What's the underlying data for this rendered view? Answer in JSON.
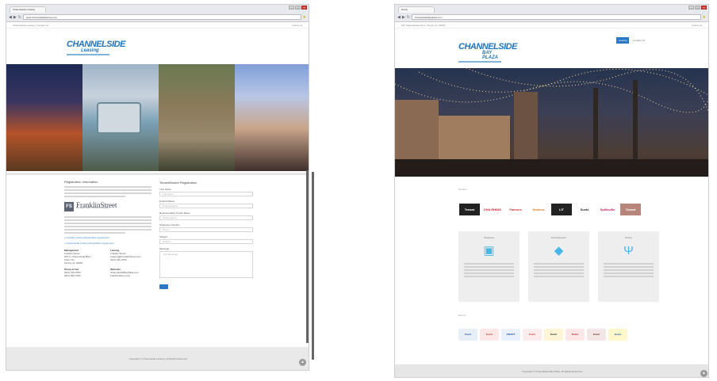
{
  "window_a": {
    "tab_title": "Channelside Leasing",
    "url": "www.channelsideleasing.com",
    "top_left": "Channelside Leasing  |  Contact Us",
    "top_right": "Follow us",
    "logo_title": "CHANNELSIDE",
    "logo_sub": "Leasing",
    "left_heading": "Registration Information",
    "franklin_mark": "FS",
    "franklin_name": "FranklinStreet",
    "franklin_tag": "Real Estate · Capital · Insurance · Management",
    "link1": "» Franklin Leasing Registration Agreement",
    "link2": "» Channelside Leasing Registration Agreement",
    "info": [
      {
        "label": "Management",
        "lines": [
          "Franklin Street",
          "615 S. Channelside Blvd",
          "Suite 734",
          "Tampa, FL 33602"
        ]
      },
      {
        "label": "Leasing",
        "lines": [
          "Franklin Street",
          "Leasing@FranklinStreet.com",
          "(813) 419-0780"
        ]
      },
      {
        "label": "Phone & Fax",
        "lines": [
          "(813) 419-0780",
          "(813) 839-7299"
        ]
      },
      {
        "label": "Websites",
        "lines": [
          "ChannelsideBayPlaza.com",
          "FranklinStreet.com"
        ]
      }
    ],
    "form_heading": "Tenant/Broker Registration",
    "fields": [
      {
        "label": "Your Name",
        "placeholder": "Full Name"
      },
      {
        "label": "Email Address",
        "placeholder": "Email Address"
      },
      {
        "label": "Representative Tenant Name",
        "placeholder": "Tenant Name"
      },
      {
        "label": "Telephone Number",
        "placeholder": "Phone"
      },
      {
        "label": "Subject",
        "placeholder": "Subject"
      }
    ],
    "message_label": "Message",
    "message_placeholder": "Your Message",
    "footer": "Copyright © Channelside Leasing. All Rights Reserved."
  },
  "window_b": {
    "tab_title": "Home",
    "url": "channelsidebayplaza.com",
    "top_left": "615 Channelside Drive, Tampa, FL 33602",
    "top_right": "Follow us",
    "logo_title": "CHANNELSIDE",
    "logo_sub": "BAY PLAZA",
    "nav_primary": "Leasing",
    "nav_secondary": "Contact Us",
    "tenants_label": "Tenants",
    "tenants": [
      "Tenant",
      "CHA RHINO",
      "Famous",
      "Hooters",
      "LIT",
      "Sushi",
      "Splitsville",
      "Tenant"
    ],
    "cards": [
      {
        "title": "Shopping",
        "icon": "▣"
      },
      {
        "title": "Entertainment",
        "icon": "◆"
      },
      {
        "title": "Dining",
        "icon": "Ψ"
      }
    ],
    "events_label": "Events",
    "logos": [
      "Event",
      "Event",
      "KMART",
      "Event",
      "Event",
      "Event",
      "Event",
      "Event"
    ],
    "footer": "Copyright © Channelside Bay Plaza. All Rights Reserved."
  }
}
